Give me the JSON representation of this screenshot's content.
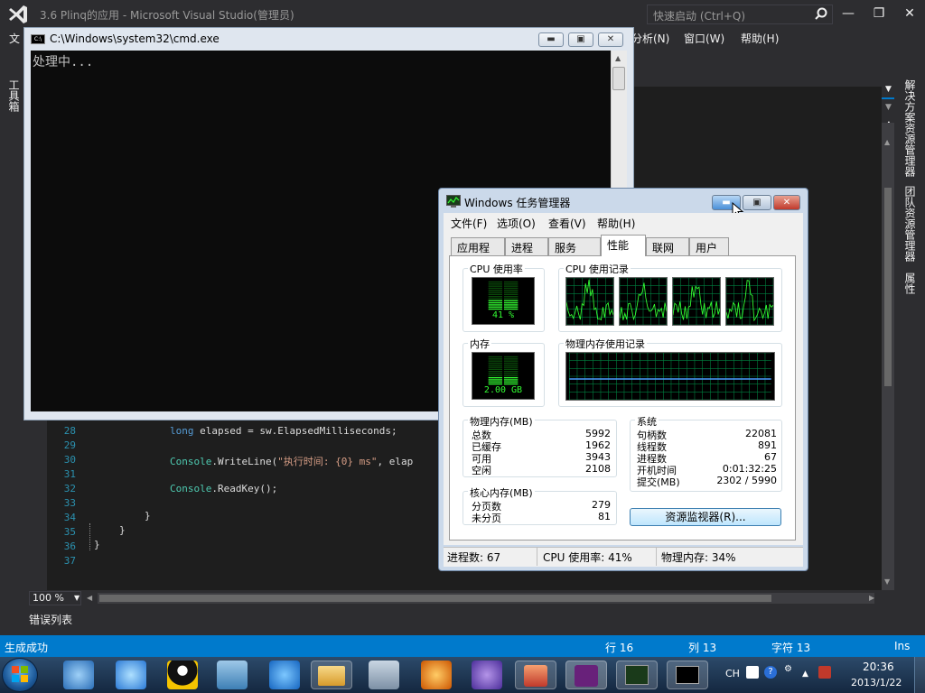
{
  "vs": {
    "title": "3.6 Plinq的应用 - Microsoft Visual Studio(管理员)",
    "quick_launch_placeholder": "快速启动 (Ctrl+Q)",
    "menu": [
      "文",
      "分析(N)",
      "窗口(W)",
      "帮助(H)"
    ],
    "toolbox_label": "工具箱",
    "right_tabs": [
      "解决方案资源管理器",
      "团队资源管理器",
      "属性"
    ],
    "zoom": "100 %",
    "error_list": "错误列表",
    "code_lines": [
      {
        "num": "28",
        "text": "long elapsed = sw.ElapsedMilliseconds;"
      },
      {
        "num": "29",
        "text": ""
      },
      {
        "num": "30",
        "text": "Console.WriteLine(\"执行时间: {0} ms\", elap"
      },
      {
        "num": "31",
        "text": ""
      },
      {
        "num": "32",
        "text": "Console.ReadKey();"
      },
      {
        "num": "33",
        "text": ""
      },
      {
        "num": "34",
        "text": "}"
      },
      {
        "num": "35",
        "text": "}"
      },
      {
        "num": "36",
        "text": "}"
      },
      {
        "num": "37",
        "text": ""
      }
    ],
    "status": {
      "message": "生成成功",
      "row": "行 16",
      "col": "列 13",
      "char": "字符 13",
      "mode": "Ins"
    }
  },
  "cmd": {
    "title": "C:\\Windows\\system32\\cmd.exe",
    "output": "处理中..."
  },
  "taskmgr": {
    "title": "Windows 任务管理器",
    "menu": [
      "文件(F)",
      "选项(O)",
      "查看(V)",
      "帮助(H)"
    ],
    "tabs": [
      "应用程序",
      "进程",
      "服务",
      "性能",
      "联网",
      "用户"
    ],
    "active_tab": "性能",
    "cpu_usage_label": "CPU 使用率",
    "cpu_usage_value": "41 %",
    "cpu_usage_fraction": 0.41,
    "cpu_history_label": "CPU 使用记录",
    "memory_label": "内存",
    "memory_value": "2.00 GB",
    "memory_fraction": 0.34,
    "mem_history_label": "物理内存使用记录",
    "physical_memory": {
      "title": "物理内存(MB)",
      "rows": [
        {
          "label": "总数",
          "value": "5992"
        },
        {
          "label": "已缓存",
          "value": "1962"
        },
        {
          "label": "可用",
          "value": "3943"
        },
        {
          "label": "空闲",
          "value": "2108"
        }
      ]
    },
    "kernel_memory": {
      "title": "核心内存(MB)",
      "rows": [
        {
          "label": "分页数",
          "value": "279"
        },
        {
          "label": "未分页",
          "value": "81"
        }
      ]
    },
    "system": {
      "title": "系统",
      "rows": [
        {
          "label": "句柄数",
          "value": "22081"
        },
        {
          "label": "线程数",
          "value": "891"
        },
        {
          "label": "进程数",
          "value": "67"
        },
        {
          "label": "开机时间",
          "value": "0:01:32:25"
        },
        {
          "label": "提交(MB)",
          "value": "2302 / 5990"
        }
      ]
    },
    "resmon_button": "资源监视器(R)...",
    "statusbar": {
      "processes": "进程数: 67",
      "cpu": "CPU 使用率: 41%",
      "memory": "物理内存: 34%"
    }
  },
  "taskbar": {
    "ime": "CH",
    "time": "20:36",
    "date": "2013/1/22"
  },
  "colors": {
    "vs_bg": "#2d2d30",
    "vs_accent": "#007acc",
    "graph_green": "#33ff33",
    "graph_grid": "#008040",
    "mem_line": "#4a9cff"
  }
}
